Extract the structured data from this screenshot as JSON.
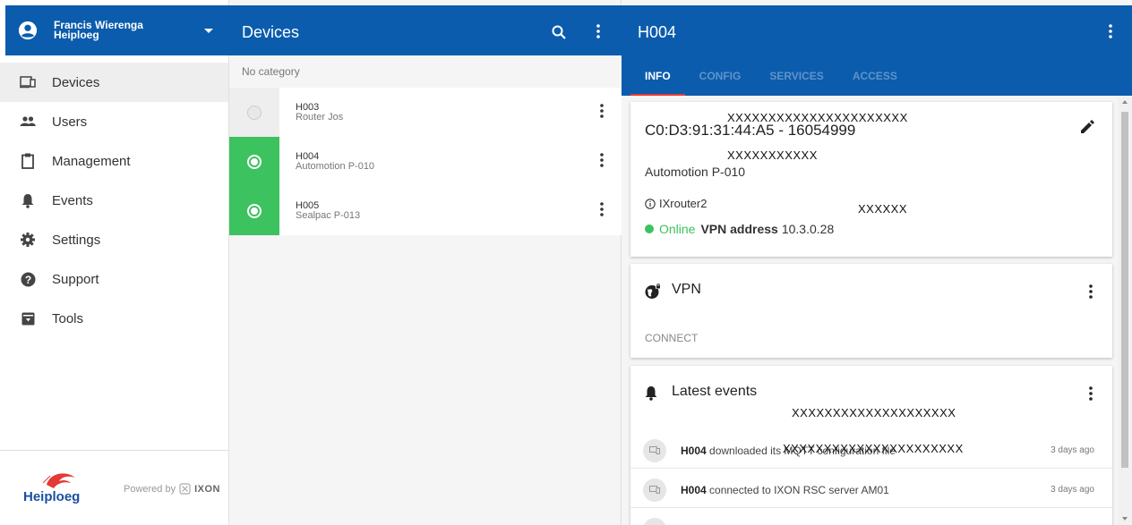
{
  "user": {
    "name": "Francis Wierenga",
    "company": "Heiploeg"
  },
  "sidebar": {
    "items": [
      {
        "label": "Devices",
        "icon": "devices-icon"
      },
      {
        "label": "Users",
        "icon": "users-icon"
      },
      {
        "label": "Management",
        "icon": "clipboard-icon"
      },
      {
        "label": "Events",
        "icon": "bell-icon"
      },
      {
        "label": "Settings",
        "icon": "gear-icon"
      },
      {
        "label": "Support",
        "icon": "help-icon"
      },
      {
        "label": "Tools",
        "icon": "toolbox-icon"
      }
    ],
    "footer": {
      "logo_text": "Heiploeg",
      "powered_by": "Powered by",
      "brand": "IXON"
    }
  },
  "devices": {
    "title": "Devices",
    "category": "No category",
    "rows": [
      {
        "name": "H003",
        "subtitle": "Router Jos",
        "selected": false
      },
      {
        "name": "H004",
        "subtitle": "Automotion P-010",
        "selected": true
      },
      {
        "name": "H005",
        "subtitle": "Sealpac P-013",
        "selected": true
      }
    ]
  },
  "detail": {
    "title": "H004",
    "tabs": [
      "INFO",
      "CONFIG",
      "SERVICES",
      "ACCESS"
    ],
    "active_tab": "INFO",
    "info": {
      "mac": "C0:D3:91:31:44:A5 - 16054999",
      "description": "Automotion P-010",
      "router": "IXrouter2",
      "status": "Online",
      "vpn_label": "VPN address",
      "vpn_address": "10.3.0.28",
      "mask1": "XXXXXXXXXXXXXXXXXXXXXX",
      "mask2": "XXXXXXXXXXX",
      "mask3": "XXXXXX"
    },
    "vpn": {
      "title": "VPN",
      "action": "CONNECT"
    },
    "events": {
      "title": "Latest events",
      "mask": "XXXXXXXXXXXXXXXXXXXX",
      "rows": [
        {
          "device": "H004",
          "text": "downloaded its MQTT configuration file",
          "time": "3 days ago",
          "mask": "XXXXXXXXXXXXXXXXXXXXXX"
        },
        {
          "device": "H004",
          "text": "connected to IXON RSC server AM01",
          "time": "3 days ago"
        }
      ]
    }
  },
  "colors": {
    "primary": "#0b5cad",
    "accent": "#3cc25f",
    "tab_indicator": "#e53935"
  }
}
